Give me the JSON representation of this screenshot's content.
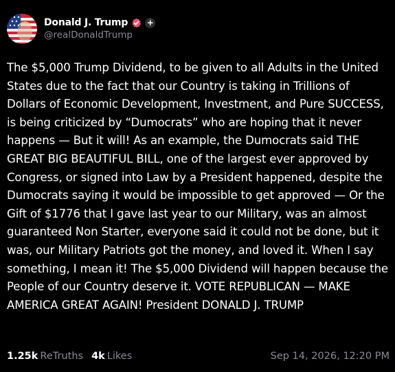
{
  "author": {
    "display_name": "Donald J. Trump",
    "handle": "@realDonaldTrump",
    "verified_icon": "verified-badge-icon",
    "verified_color": "#e05870",
    "extra_badge": "+"
  },
  "post": {
    "text": "The $5,000 Trump Dividend, to be given to all Adults in the United States due to the fact that our Country is taking in Trillions of Dollars of Economic Development, Investment, and Pure SUCCESS, is being criticized by “Dumocrats” who are hoping that it never happens — But it will! As an example, the Dumocrats said THE GREAT BIG BEAUTIFUL BILL, one of the largest ever approved by Congress, or signed into Law by a President happened, despite the Dumocrats saying it would be impossible to get approved — Or the Gift of $1776 that I gave last year to our Military, was an almost guaranteed Non Starter, everyone said it could not be done, but it was, our Military Patriots got the money, and loved it. When I say something, I mean it! The $5,000 Dividend will happen because the People of our Country deserve it. VOTE REPUBLICAN — MAKE AMERICA GREAT AGAIN! President DONALD J. TRUMP"
  },
  "stats": {
    "retruths_count": "1.25k",
    "retruths_label": "ReTruths",
    "likes_count": "4k",
    "likes_label": "Likes"
  },
  "timestamp": "Sep 14, 2026, 12:20 PM",
  "colors": {
    "background": "#000000",
    "text": "#ffffff",
    "muted": "#8b8b93"
  }
}
